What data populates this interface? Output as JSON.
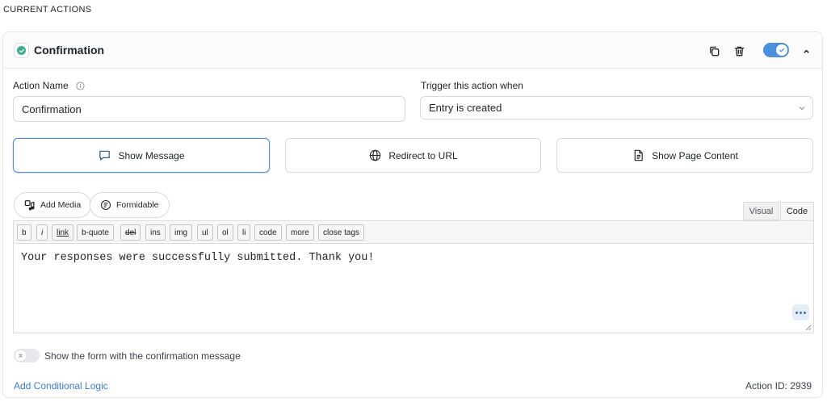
{
  "section": {
    "title": "CURRENT ACTIONS"
  },
  "card": {
    "title": "Confirmation",
    "enabled": true,
    "icons": {
      "status": "check-circle-icon",
      "duplicate": "duplicate-icon",
      "delete": "trash-icon",
      "collapse": "chevron-up-icon"
    }
  },
  "fields": {
    "action_name_label": "Action Name",
    "action_name_value": "Confirmation",
    "trigger_label": "Trigger this action when",
    "trigger_value": "Entry is created"
  },
  "types": [
    {
      "label": "Show Message",
      "icon": "speech-bubble-icon",
      "active": true
    },
    {
      "label": "Redirect to URL",
      "icon": "globe-icon",
      "active": false
    },
    {
      "label": "Show Page Content",
      "icon": "document-icon",
      "active": false
    }
  ],
  "media": {
    "add_media": "Add Media",
    "formidable": "Formidable"
  },
  "editor_tabs": {
    "visual": "Visual",
    "code": "Code"
  },
  "quicktags": [
    "b",
    "i",
    "link",
    "b-quote",
    "del",
    "ins",
    "img",
    "ul",
    "ol",
    "li",
    "code",
    "more",
    "close tags"
  ],
  "editor": {
    "content": "Your responses were successfully submitted. Thank you!"
  },
  "options": {
    "show_form_label": "Show the form with the confirmation message",
    "show_form_enabled": false
  },
  "footer": {
    "conditional_logic": "Add Conditional Logic",
    "action_id": "Action ID: 2939"
  },
  "colors": {
    "accent": "#4a90e2",
    "success": "#3bb08f",
    "link": "#3a7bd5"
  }
}
